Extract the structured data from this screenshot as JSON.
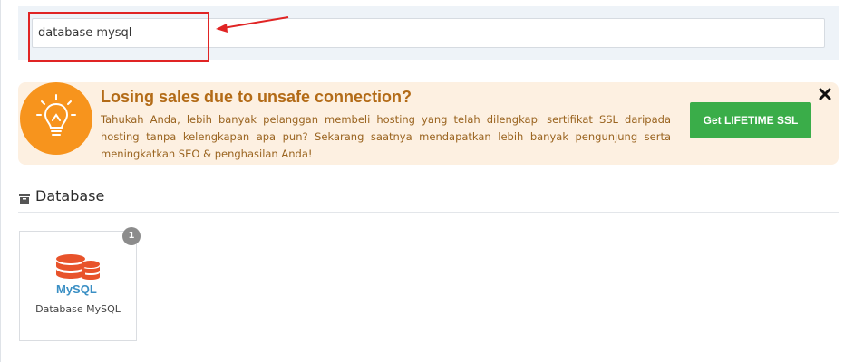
{
  "search": {
    "value": "database mysql"
  },
  "promo": {
    "title": "Losing sales due to unsafe connection?",
    "text": "Tahukah Anda, lebih banyak pelanggan membeli hosting yang telah dilengkapi sertifikat SSL daripada hosting tanpa kelengkapan apa pun? Sekarang saatnya mendapatkan lebih banyak pengunjung serta meningkatkan SEO & penghasilan Anda!",
    "button_label": "Get LIFETIME SSL",
    "icon": "lightbulb-icon"
  },
  "section": {
    "title": "Database",
    "icon": "archive-icon"
  },
  "tiles": [
    {
      "label": "Database MySQL",
      "logo_text": "MySQL",
      "badge": "1",
      "icon": "mysql-logo"
    }
  ],
  "colors": {
    "promo_background": "#fdf0e1",
    "promo_icon": "#f7941d",
    "promo_title": "#b36b17",
    "button": "#3aad49",
    "highlight": "#e02424",
    "mysql_red": "#e8532b",
    "mysql_blue": "#3a8fc4"
  }
}
